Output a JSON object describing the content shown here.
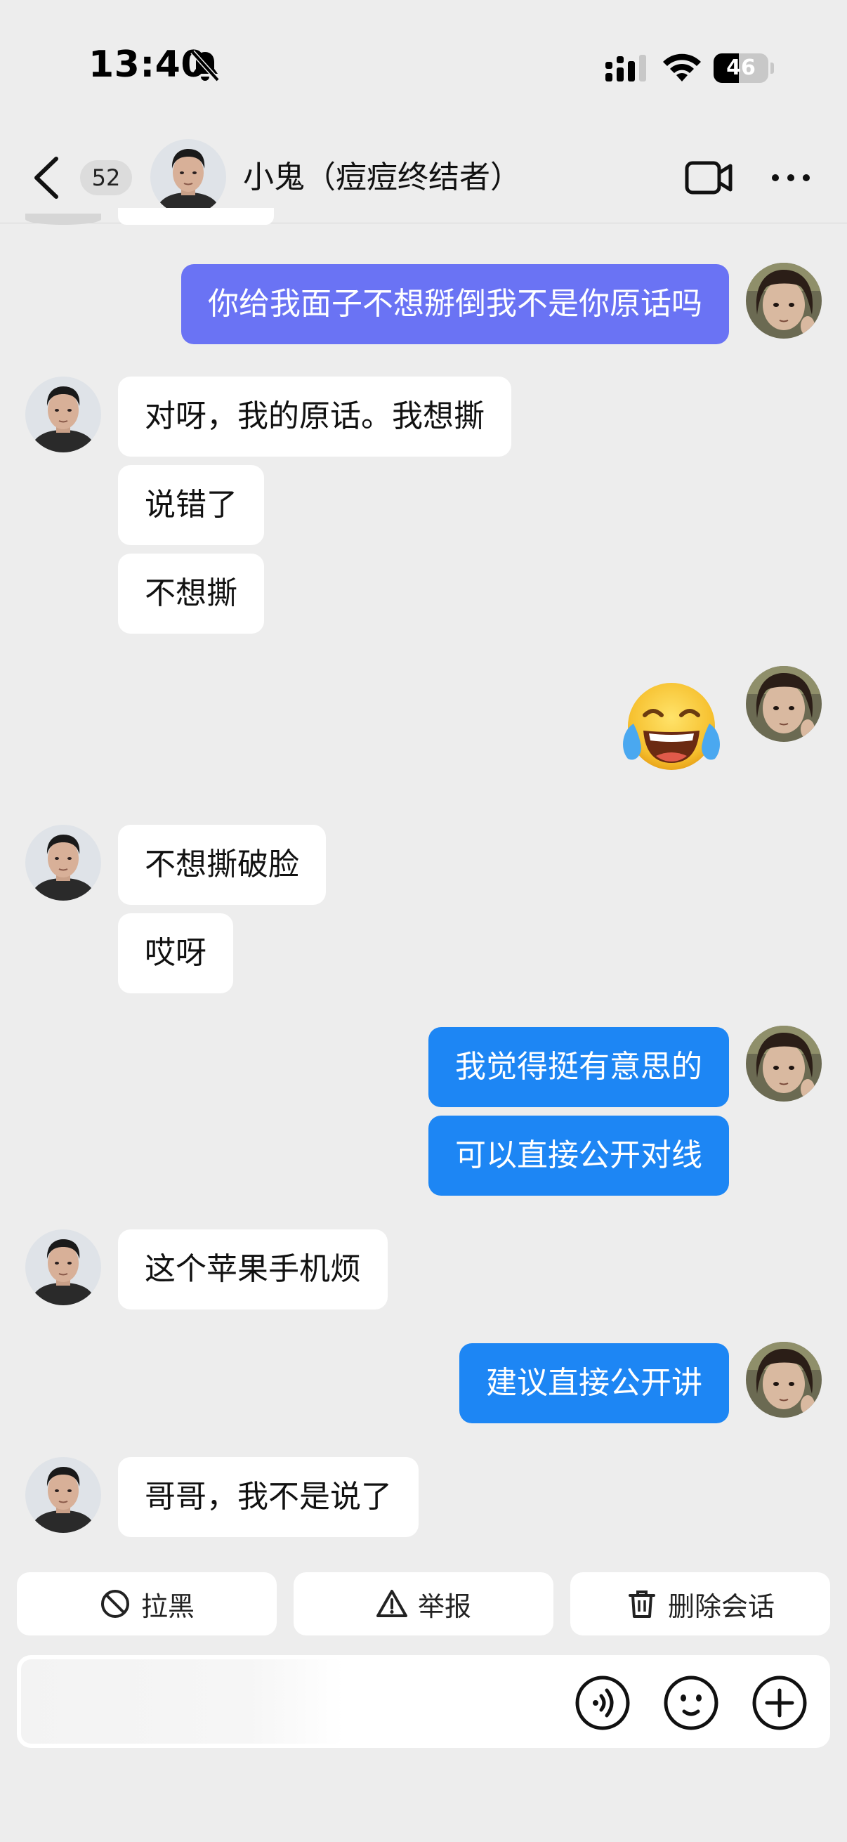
{
  "status_bar": {
    "time": "13:40",
    "battery_level": 46,
    "battery_label": "46"
  },
  "header": {
    "unread_count": "52",
    "contact_name": "小鬼（痘痘终结者）"
  },
  "messages": [
    {
      "side": "out",
      "text": "你给我面子不想掰倒我不是你原话吗",
      "color": "#6a73f4"
    },
    {
      "side": "in",
      "text": "对呀，我的原话。我想撕"
    },
    {
      "side": "in",
      "text": "说错了"
    },
    {
      "side": "in",
      "text": "不想撕"
    },
    {
      "side": "out",
      "emoji": "😂",
      "icon": "face-with-tears-of-joy-emoji"
    },
    {
      "side": "in",
      "text": "不想撕破脸"
    },
    {
      "side": "in",
      "text": "哎呀"
    },
    {
      "side": "out",
      "text": "我觉得挺有意思的",
      "color": "#1d86f4"
    },
    {
      "side": "out",
      "text": "可以直接公开对线",
      "color": "#1d86f4"
    },
    {
      "side": "in",
      "text": "这个苹果手机烦"
    },
    {
      "side": "out",
      "text": "建议直接公开讲",
      "color": "#1d86f4"
    },
    {
      "side": "in",
      "text": "哥哥，我不是说了"
    }
  ],
  "actions": {
    "block_label": "拉黑",
    "report_label": "举报",
    "delete_label": "删除会话"
  },
  "input": {
    "value": "",
    "icons": [
      "voice-icon",
      "emoji-icon",
      "plus-icon"
    ]
  },
  "colors": {
    "background": "#ededed",
    "bubble_in": "#ffffff",
    "bubble_out_blue": "#1d86f4",
    "bubble_out_purple": "#6a73f4"
  }
}
